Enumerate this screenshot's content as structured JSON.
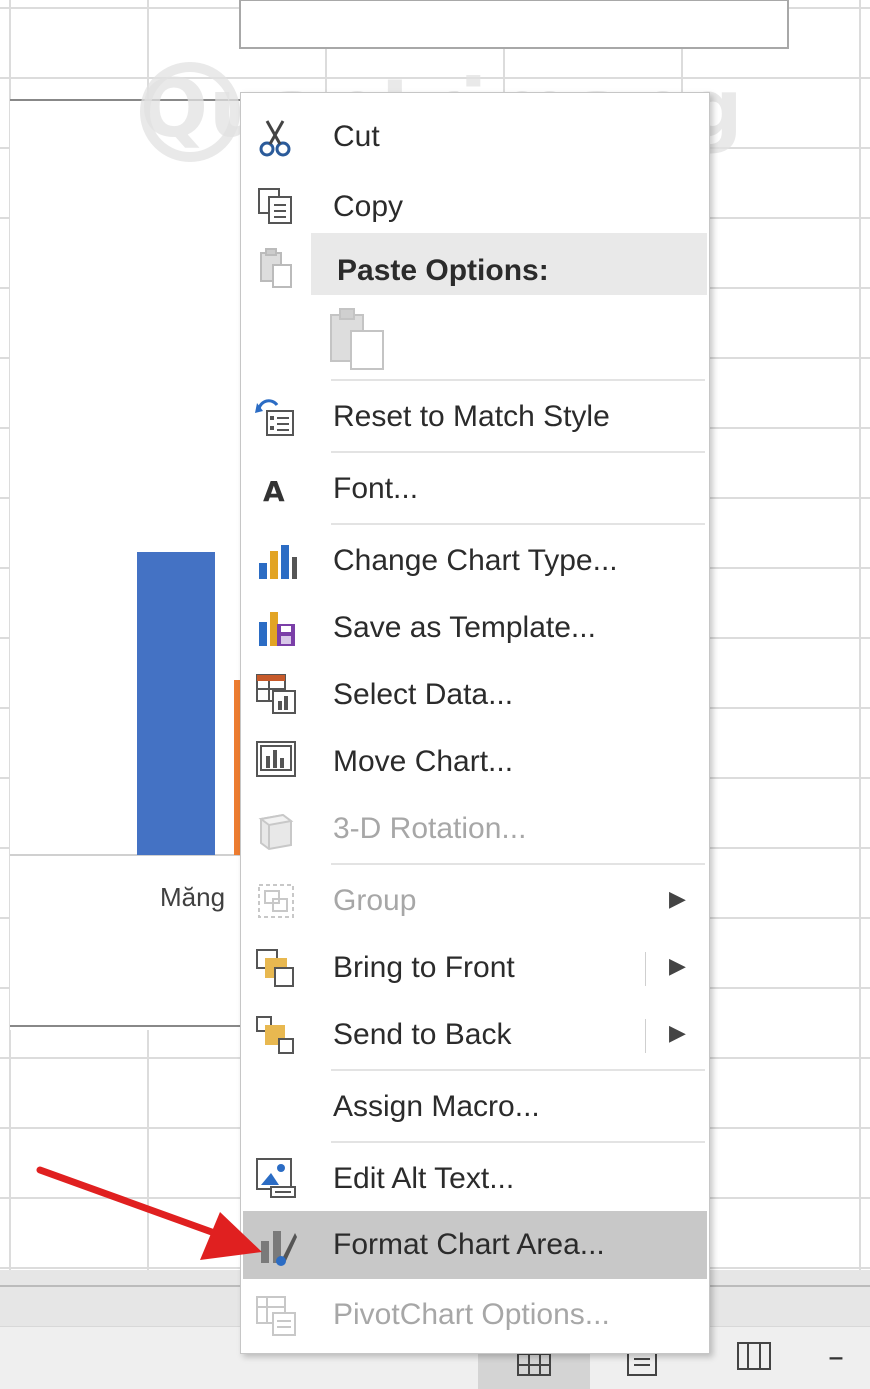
{
  "watermark": "Quantrimang",
  "chart": {
    "axis_label": "Măng",
    "bar_color": "#4472C4",
    "second_bar_color": "#ED7D31"
  },
  "menu": {
    "cut": "Cut",
    "copy": "Copy",
    "paste_options": "Paste Options:",
    "reset_style": "Reset to Match Style",
    "font": "Font...",
    "change_chart_type": "Change Chart Type...",
    "save_template": "Save as Template...",
    "select_data": "Select Data...",
    "move_chart": "Move Chart...",
    "rotation_3d": "3-D Rotation...",
    "group": "Group",
    "bring_front": "Bring to Front",
    "send_back": "Send to Back",
    "assign_macro": "Assign Macro...",
    "edit_alt": "Edit Alt Text...",
    "format_chart_area": "Format Chart Area...",
    "pivotchart_options": "PivotChart Options..."
  },
  "icons": {
    "cut": "scissors-icon",
    "copy": "copy-icon",
    "paste": "paste-icon",
    "reset": "reset-style-icon",
    "font": "font-icon",
    "change_type": "bar-chart-icon",
    "save_template": "save-template-icon",
    "select_data": "select-data-icon",
    "move_chart": "move-chart-icon",
    "rotation": "cube-icon",
    "group": "group-icon",
    "bring_front": "bring-front-icon",
    "send_back": "send-back-icon",
    "alt_text": "alt-text-icon",
    "format_area": "format-area-icon",
    "pivot": "pivot-options-icon"
  },
  "colors": {
    "selected_row": "#c8c8c8",
    "annotation_arrow": "#e02020",
    "disabled_text": "#a7a7a7"
  },
  "statusbar": {
    "zoom_minus": "–"
  }
}
